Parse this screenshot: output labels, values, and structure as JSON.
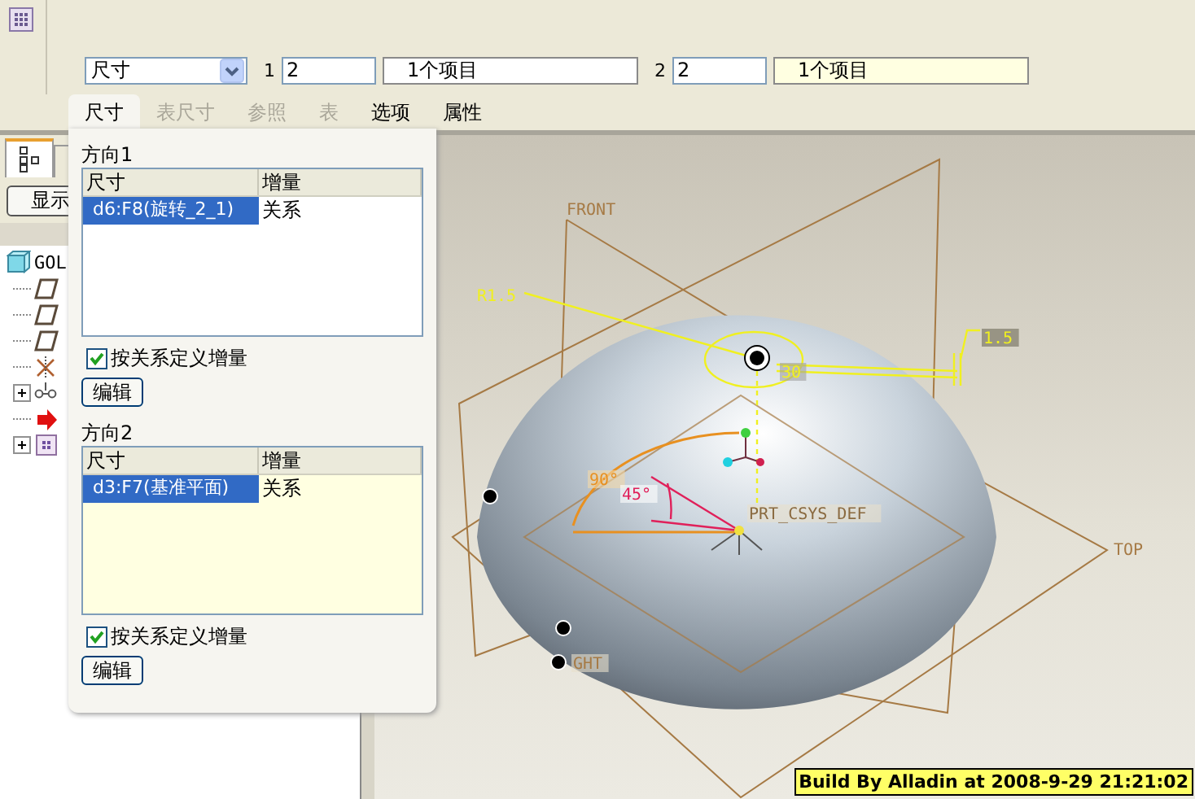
{
  "toolbar": {
    "filter": "尺寸",
    "collectors": [
      {
        "label": "1",
        "count": "2",
        "summary": "1个项目",
        "active": false
      },
      {
        "label": "2",
        "count": "2",
        "summary": "1个项目",
        "active": true
      }
    ]
  },
  "tabs": [
    {
      "label": "尺寸",
      "selected": true,
      "disabled": false
    },
    {
      "label": "表尺寸",
      "selected": false,
      "disabled": true
    },
    {
      "label": "参照",
      "selected": false,
      "disabled": true
    },
    {
      "label": "表",
      "selected": false,
      "disabled": true
    },
    {
      "label": "选项",
      "selected": false,
      "disabled": false
    },
    {
      "label": "属性",
      "selected": false,
      "disabled": false
    }
  ],
  "directions": [
    {
      "title": "方向1",
      "active": false,
      "columns": [
        "尺寸",
        "增量"
      ],
      "rows": [
        {
          "dimension": "d6:F8(旋转_2_1)",
          "increment": "关系",
          "selected": true
        }
      ],
      "relation_option": {
        "label": "按关系定义增量",
        "checked": true
      },
      "button": "编辑"
    },
    {
      "title": "方向2",
      "active": true,
      "columns": [
        "尺寸",
        "增量"
      ],
      "rows": [
        {
          "dimension": "d3:F7(基准平面)",
          "increment": "关系",
          "selected": true
        }
      ],
      "relation_option": {
        "label": "按关系定义增量",
        "checked": true
      },
      "button": "编辑"
    }
  ],
  "model_tree": {
    "show_button": "显示",
    "items": [
      {
        "kind": "part",
        "label": "GOL",
        "children": [
          {
            "kind": "plane"
          },
          {
            "kind": "plane"
          },
          {
            "kind": "plane"
          },
          {
            "kind": "csys"
          },
          {
            "kind": "group",
            "expanded": false
          },
          {
            "kind": "insert"
          },
          {
            "kind": "feature",
            "expanded": false
          }
        ]
      }
    ]
  },
  "viewport": {
    "front_plane": "FRONT",
    "top_plane": "TOP",
    "right_plane": "GHT",
    "radius_dim": "R1.5",
    "offset_dim": "1.5",
    "hidden_dim": "30",
    "angle_dim": "90°",
    "pattern_angle": "45°",
    "csys": "PRT_CSYS_DEF"
  },
  "stamp": "Build By Alladin at 2008-9-29 21:21:02"
}
